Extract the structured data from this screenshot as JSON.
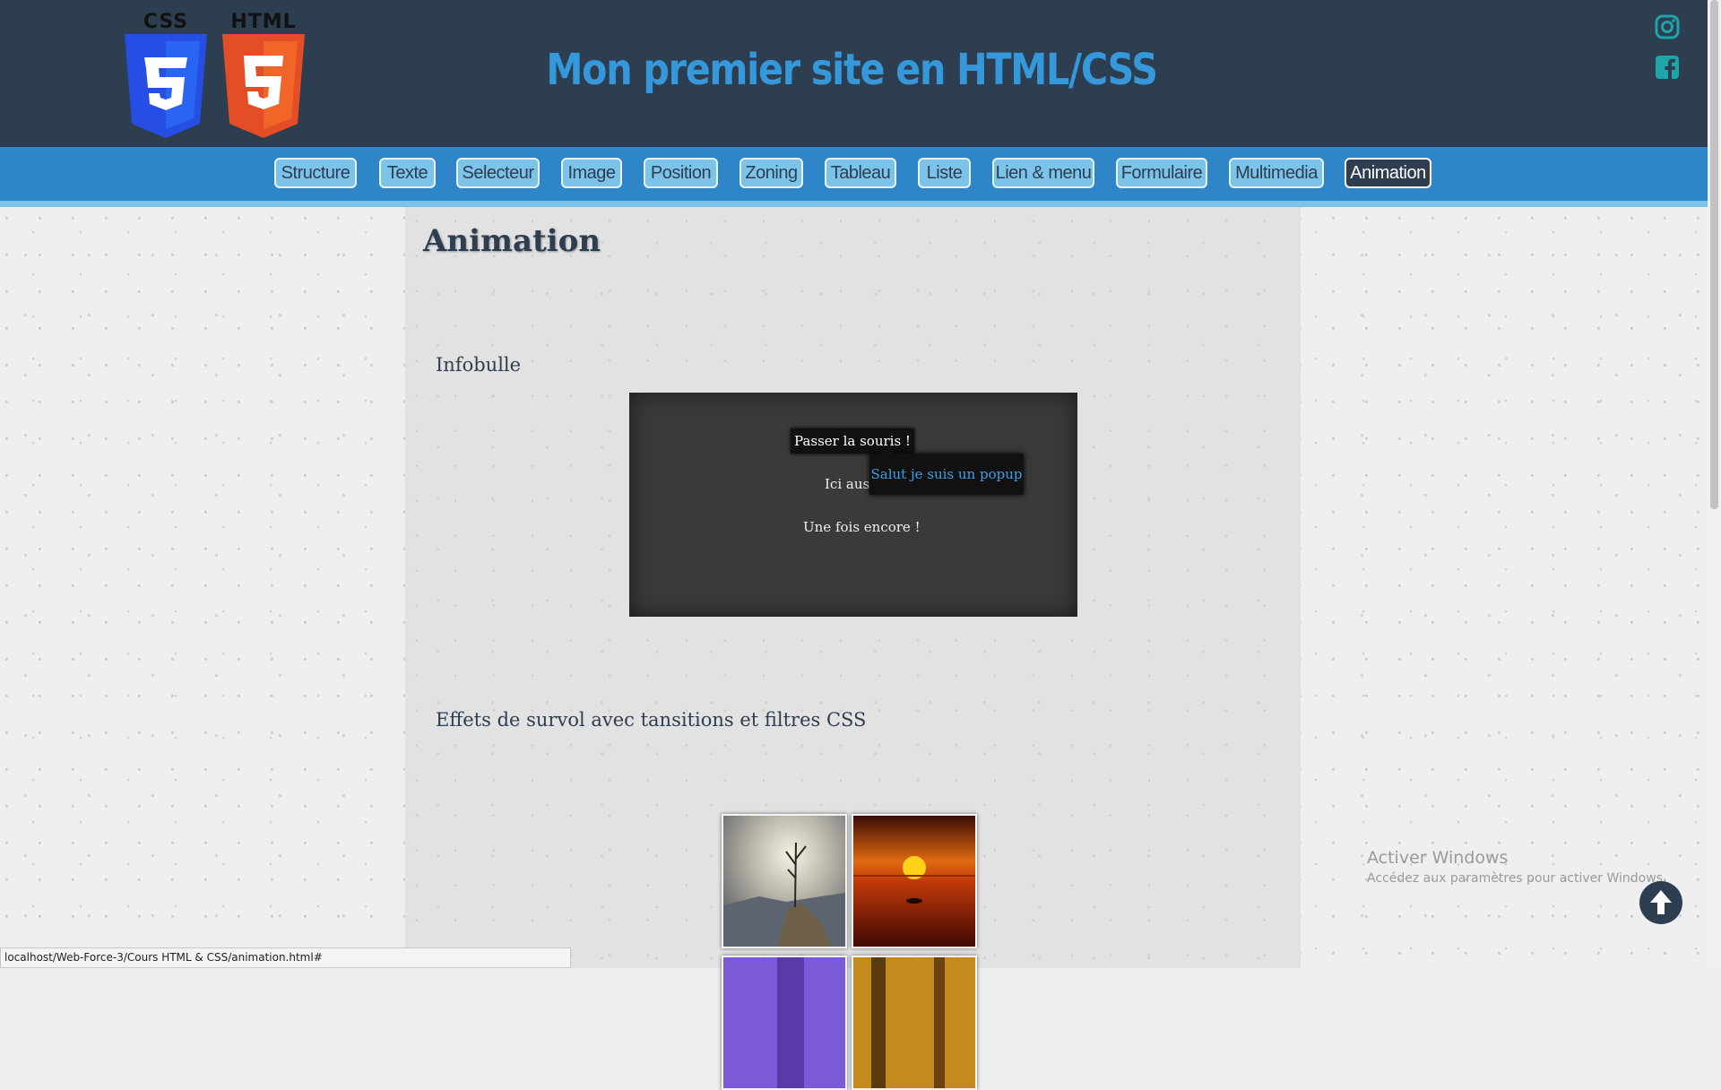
{
  "header": {
    "logos": [
      {
        "label": "CSS",
        "icon": "css3-shield-icon",
        "color": "#264de4"
      },
      {
        "label": "HTML",
        "icon": "html5-shield-icon",
        "color": "#e44d26"
      }
    ],
    "site_title": "Mon premier site en HTML/CSS",
    "social": [
      "instagram-icon",
      "facebook-icon"
    ],
    "colors": {
      "background": "#2d3e50",
      "title": "#3498db",
      "social": "#1fa5a8"
    }
  },
  "nav": {
    "items": [
      {
        "label": "Structure"
      },
      {
        "label": "Texte"
      },
      {
        "label": "Selecteur"
      },
      {
        "label": "Image"
      },
      {
        "label": "Position"
      },
      {
        "label": "Zoning"
      },
      {
        "label": "Tableau"
      },
      {
        "label": "Liste"
      },
      {
        "label": "Lien & menu"
      },
      {
        "label": "Formulaire"
      },
      {
        "label": "Multimedia"
      },
      {
        "label": "Animation",
        "active": true
      }
    ],
    "colors": {
      "bar": "#2e86c8",
      "item": "#7cc3ea",
      "active": "#2d3e50"
    }
  },
  "main": {
    "page_title": "Animation",
    "infobulle": {
      "title": "Infobulle",
      "hover_button": "Passer la souris !",
      "line2": "Ici aussi",
      "line3": "Une fois encore !",
      "popup": "Salut je suis un popup"
    },
    "effects": {
      "title": "Effets de survol avec tansitions et filtres CSS",
      "images": [
        "landscape-tree-photo",
        "sunset-sea-photo",
        "purple-sky-photo",
        "autumn-trees-photo"
      ]
    }
  },
  "status_bar": "localhost/Web-Force-3/Cours HTML & CSS/animation.html#",
  "windows_watermark": {
    "title": "Activer Windows",
    "subtitle": "Accédez aux paramètres pour activer Windows."
  },
  "scroll_top": {
    "icon": "arrow-up-circle-icon"
  }
}
